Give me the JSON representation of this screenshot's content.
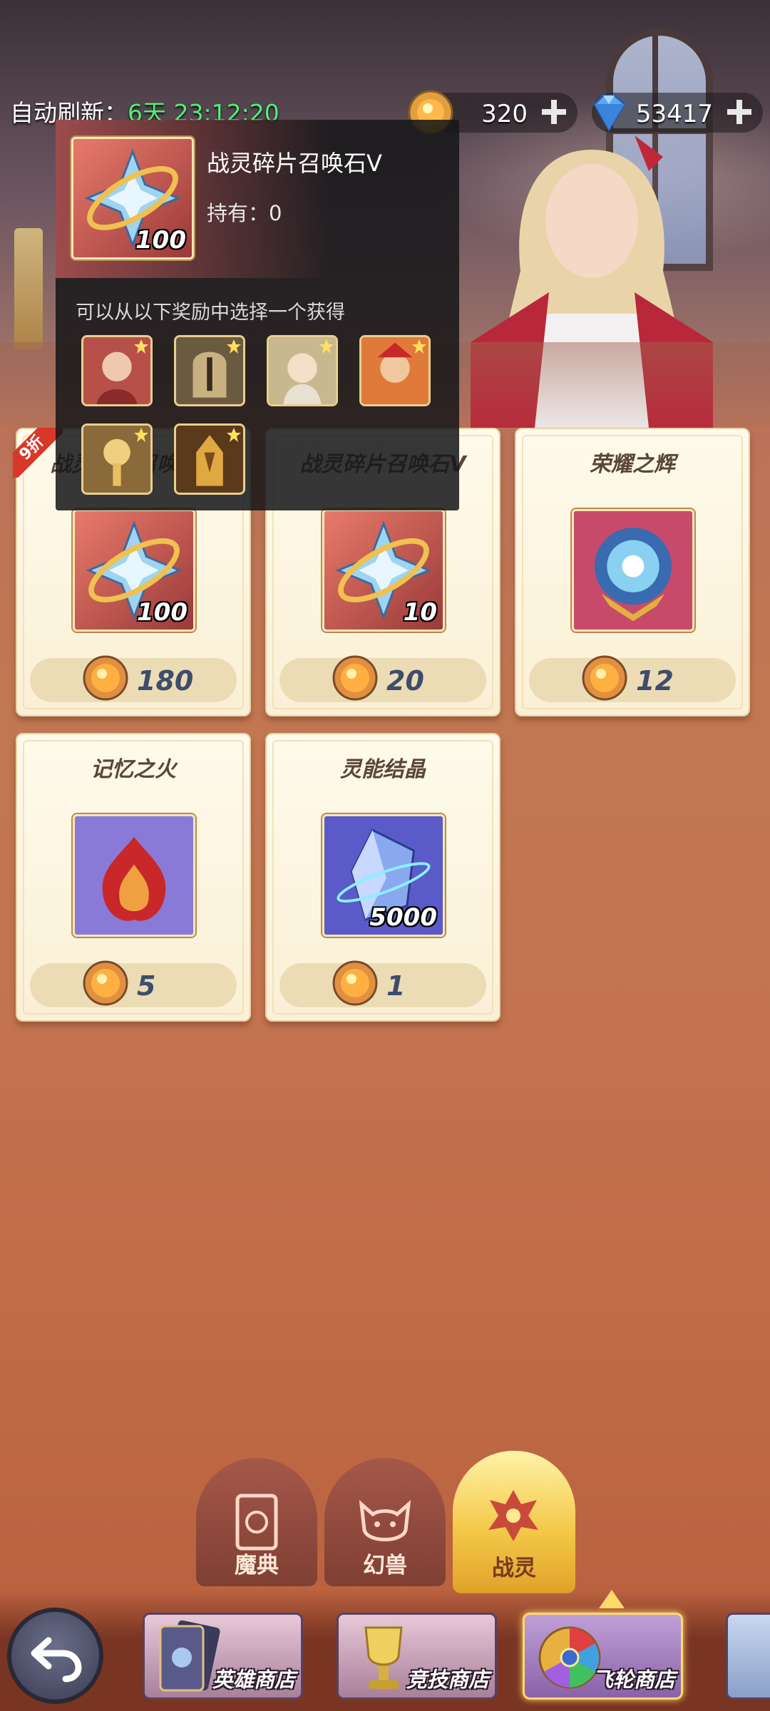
{
  "header": {
    "refresh_label": "自动刷新：",
    "refresh_time": "6天 23:12:20",
    "gold_currency": {
      "value": "320",
      "icon": "gold-coin-icon"
    },
    "gem_currency": {
      "value": "53417",
      "icon": "diamond-icon"
    }
  },
  "tooltip": {
    "item_name": "战灵碎片召唤石V",
    "owned": "持有：0",
    "item_qty": "100",
    "description": "可以从以下奖励中选择一个获得",
    "rewards": [
      "reward-1",
      "reward-2",
      "reward-3",
      "reward-4",
      "reward-5",
      "reward-6"
    ]
  },
  "shop": {
    "discount_badge": "9折",
    "items": [
      {
        "title": "战灵碎片召唤石V",
        "qty": "100",
        "price": "180"
      },
      {
        "title": "战灵碎片召唤石V",
        "qty": "10",
        "price": "20"
      },
      {
        "title": "荣耀之辉",
        "qty": "",
        "price": "12"
      },
      {
        "title": "记忆之火",
        "qty": "",
        "price": "5"
      },
      {
        "title": "灵能结晶",
        "qty": "5000",
        "price": "1"
      }
    ]
  },
  "categories": [
    {
      "label": "魔典",
      "icon": "tome-icon"
    },
    {
      "label": "幻兽",
      "icon": "beast-icon"
    },
    {
      "label": "战灵",
      "icon": "spirit-icon",
      "active": true
    }
  ],
  "shops": [
    {
      "label": "英雄商店",
      "icon": "hero-card-icon"
    },
    {
      "label": "竞技商店",
      "icon": "trophy-icon"
    },
    {
      "label": "飞轮商店",
      "icon": "flywheel-icon",
      "active": true
    }
  ],
  "colors": {
    "timer_green": "#4ef07a",
    "price_text": "#3e4d6c",
    "active_tab": "#f4c94a",
    "discount_red": "#d8382a"
  }
}
